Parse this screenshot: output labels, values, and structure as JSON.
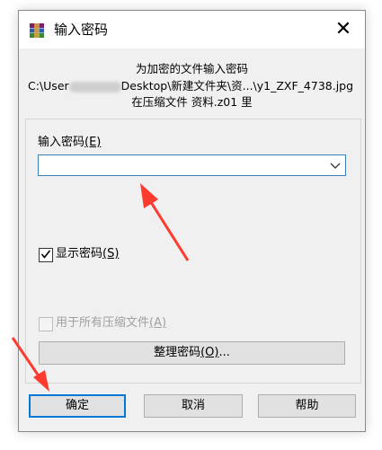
{
  "window": {
    "title": "输入密码",
    "close_symbol": "✕"
  },
  "info": {
    "line1": "为加密的文件输入密码",
    "path_prefix": "C:\\User",
    "path_suffix": "Desktop\\新建文件夹\\资...\\y1_ZXF_4738.jpg",
    "line3": "在压缩文件 资料.z01 里"
  },
  "password": {
    "label": "输入密码",
    "accesskey": "(E)",
    "value": ""
  },
  "show_password": {
    "label": "显示密码",
    "accesskey": "(S)",
    "checked": true
  },
  "use_for_all": {
    "label": "用于所有压缩文件",
    "accesskey": "(A)",
    "checked": false,
    "enabled": false
  },
  "organize_button": {
    "label": "整理密码",
    "accesskey": "(O)",
    "ellipsis": "..."
  },
  "buttons": {
    "ok": "确定",
    "cancel": "取消",
    "help": "帮助"
  },
  "colors": {
    "focus_border": "#0078d7",
    "annotation_arrow": "#ff3b2f"
  },
  "icons": {
    "app": "winrar-icon",
    "dropdown": "chevron-down-icon",
    "check": "check-icon"
  }
}
